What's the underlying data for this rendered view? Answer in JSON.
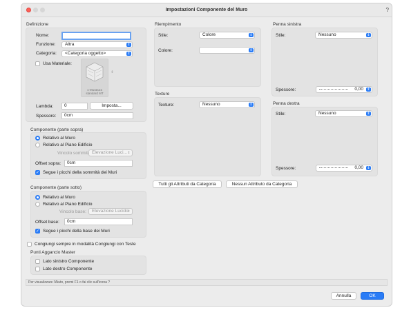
{
  "window": {
    "title": "Impostazioni Componente del Muro",
    "help": "?"
  },
  "definizione": {
    "section": "Definizione",
    "nome_label": "Nome:",
    "nome_value": "",
    "funzione_label": "Funzione:",
    "funzione_value": "Altra",
    "categoria_label": "Categoria:",
    "categoria_value": "<Categoria oggetto>",
    "usa_materiale": "Usa Materiale:",
    "materiale_tile": "1-Muratura standard MT",
    "lambda_label": "Lambda:",
    "lambda_value": "0",
    "imposta": "Imposta...",
    "spessore_label": "Spessore:",
    "spessore_value": "0cm"
  },
  "sopra": {
    "section": "Componente (parte sopra)",
    "radio1": "Relativo al Muro",
    "radio2": "Relativo al Piano Edificio",
    "vincolo_label": "Vincolo sommità:",
    "vincolo_value": "Elevazione Luci...",
    "offset_label": "Offset sopra:",
    "offset_value": "0cm",
    "segue": "Segue i picchi della sommità dei Muri"
  },
  "sotto": {
    "section": "Componente (parte sotto)",
    "radio1": "Relativo al Muro",
    "radio2": "Relativo al Piano Edificio",
    "vincolo_label": "Vincolo base:",
    "vincolo_value": "Elevazione Lucido",
    "offset_label": "Offset base:",
    "offset_value": "0cm",
    "segue": "Segue i picchi della base dei Muri"
  },
  "congiungi": "Congiungi sempre in modalità Congiungi con Teste",
  "aggancio": {
    "section": "Punti Aggancio Master",
    "sinistro": "Lato sinistro Componente",
    "destro": "Lato destro Componente"
  },
  "riempimento": {
    "section": "Riempimento",
    "stile_label": "Stile:",
    "stile_value": "Colore",
    "colore_label": "Colore:",
    "colore_value": ""
  },
  "texture": {
    "section": "Texture",
    "label": "Texture:",
    "value": "Nessuno"
  },
  "penna_sinistra": {
    "section": "Penna sinistra",
    "stile_label": "Stile:",
    "stile_value": "Nessuno",
    "spessore_label": "Spessore:",
    "spessore_value": "0,00"
  },
  "penna_destra": {
    "section": "Penna destra",
    "stile_label": "Stile:",
    "stile_value": "Nessuno",
    "spessore_label": "Spessore:",
    "spessore_value": "0,00"
  },
  "buttons": {
    "tutti": "Tutti gli Attributi da Categoria",
    "nessun": "Nessun Attributo da Categoria",
    "annulla": "Annulla",
    "ok": "OK"
  },
  "status": "Per visualizzare l'Aiuto, premi F1 o fai clic sull'icona ?",
  "icons": {
    "chevron": "updown-chevron-icon",
    "check": "checkmark-icon"
  },
  "colors": {
    "accent": "#2a7cf6",
    "close": "#fe5f57"
  }
}
